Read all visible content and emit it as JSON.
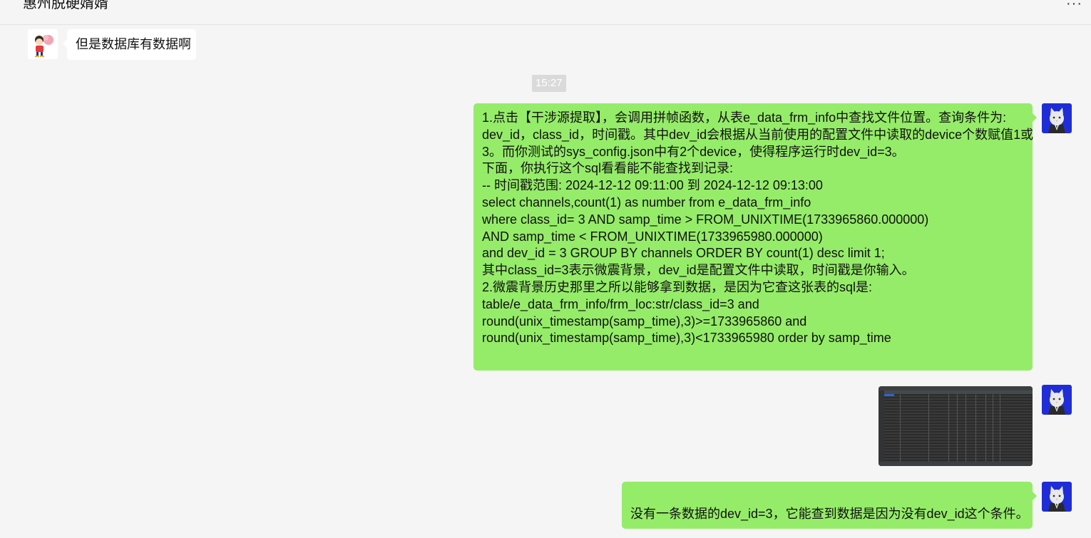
{
  "header": {
    "title": "惠州脱硬婿婿",
    "more_label": "···"
  },
  "messages": {
    "m1": {
      "text": "但是数据库有数据啊"
    },
    "timestamp": "15:27",
    "m2": {
      "lines": [
        "1.点击【干涉源提取】，会调用拼帧函数，从表e_data_frm_info中查找文件位置。查询条件为:",
        "dev_id，class_id，时间戳。其中dev_id会根据从当前使用的配置文件中读取的device个数赋值1或",
        "3。而你测试的sys_config.json中有2个device，使得程序运行时dev_id=3。",
        "下面，你执行这个sql看看能不能查找到记录:",
        "-- 时间戳范围: 2024-12-12 09:11:00 到 2024-12-12 09:13:00",
        "select channels,count(1) as number from e_data_frm_info",
        "where class_id= 3  AND samp_time > FROM_UNIXTIME(1733965860.000000)",
        "AND samp_time < FROM_UNIXTIME(1733965980.000000)",
        "and dev_id = 3 GROUP BY channels ORDER BY count(1) desc limit 1;",
        "其中class_id=3表示微震背景，dev_id是配置文件中读取，时间戳是你输入。",
        "2.微震背景历史那里之所以能够拿到数据，是因为它查这张表的sql是:",
        "table/e_data_frm_info/frm_loc:str/class_id=3 and",
        "round(unix_timestamp(samp_time),3)>=1733965860 and",
        "round(unix_timestamp(samp_time),3)<1733965980 order by samp_time"
      ]
    },
    "m4": {
      "text": "没有一条数据的dev_id=3，它能查到数据是因为没有dev_id这个条件。"
    }
  },
  "colors": {
    "background": "#f5f5f5",
    "incoming_bubble": "#ffffff",
    "outgoing_bubble": "#95ec69",
    "timestamp_bg": "#dadada"
  }
}
